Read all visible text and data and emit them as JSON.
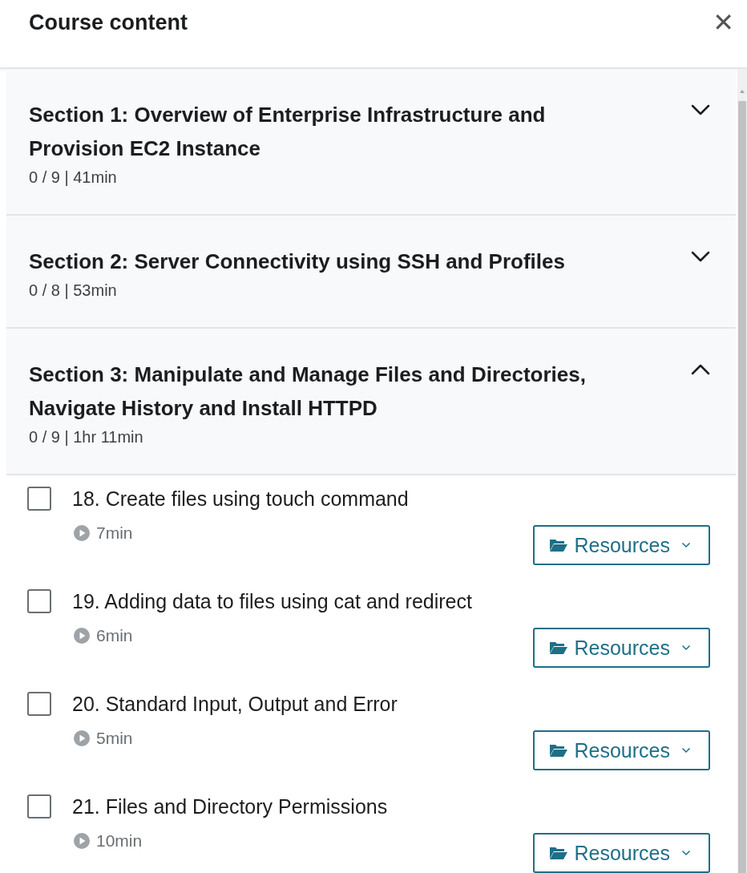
{
  "header": {
    "title": "Course content",
    "close_icon": "✕"
  },
  "sections": [
    {
      "title": "Section 1: Overview of Enterprise Infrastructure and Provision EC2 Instance",
      "meta": "0 / 9 | 41min",
      "expanded": false
    },
    {
      "title": "Section 2: Server Connectivity using SSH and Profiles",
      "meta": "0 / 8 | 53min",
      "expanded": false
    },
    {
      "title": "Section 3: Manipulate and Manage Files and Directories, Navigate History and Install HTTPD",
      "meta": "0 / 9 | 1hr 11min",
      "expanded": true,
      "lectures": [
        {
          "title": "18. Create files using touch command",
          "duration": "7min",
          "checked": false,
          "resources": "Resources"
        },
        {
          "title": "19. Adding data to files using cat and redirect",
          "duration": "6min",
          "checked": false,
          "resources": "Resources"
        },
        {
          "title": "20. Standard Input, Output and Error",
          "duration": "5min",
          "checked": false,
          "resources": "Resources"
        },
        {
          "title": "21. Files and Directory Permissions",
          "duration": "10min",
          "checked": false,
          "resources": "Resources"
        }
      ]
    }
  ]
}
